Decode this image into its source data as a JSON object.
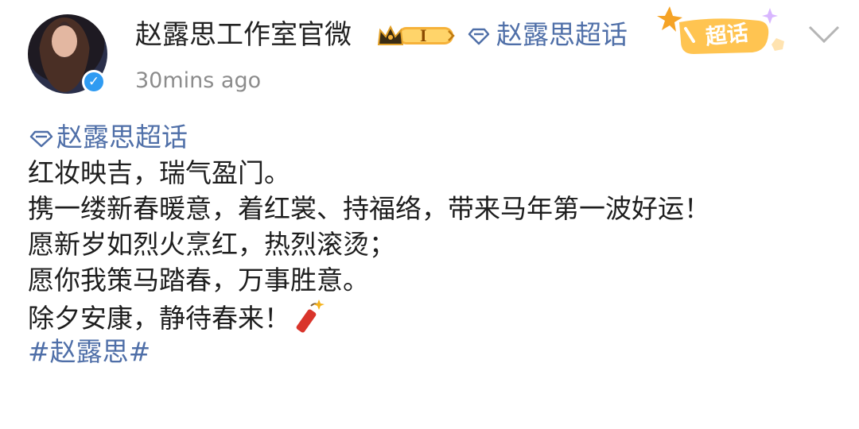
{
  "header": {
    "user_name": "赵露思工作室官微",
    "level_badge": "I",
    "supertopic_link": "赵露思超话",
    "chaohua_badge": "超话",
    "timestamp": "30mins ago"
  },
  "post": {
    "topic_tag": "赵露思超话",
    "lines": [
      "红妆映吉，瑞气盈门。",
      "携一缕新春暖意，着红裳、持福络，带来马年第一波好运！",
      "愿新岁如烈火烹红，热烈滚烫；",
      "愿你我策马踏春，万事胜意。",
      "除夕安康，静待春来！"
    ],
    "hashtag": "#赵露思#"
  },
  "colors": {
    "link": "#4f6fa8",
    "text": "#1e1e1e",
    "muted": "#8c8c8c",
    "verified": "#2f9bf2",
    "badge_gold": "#f6b23a"
  },
  "icons": [
    "verified-icon",
    "crown-icon",
    "gem-icon",
    "chaohua-badge-icon",
    "chevron-down-icon",
    "firecracker-icon"
  ]
}
